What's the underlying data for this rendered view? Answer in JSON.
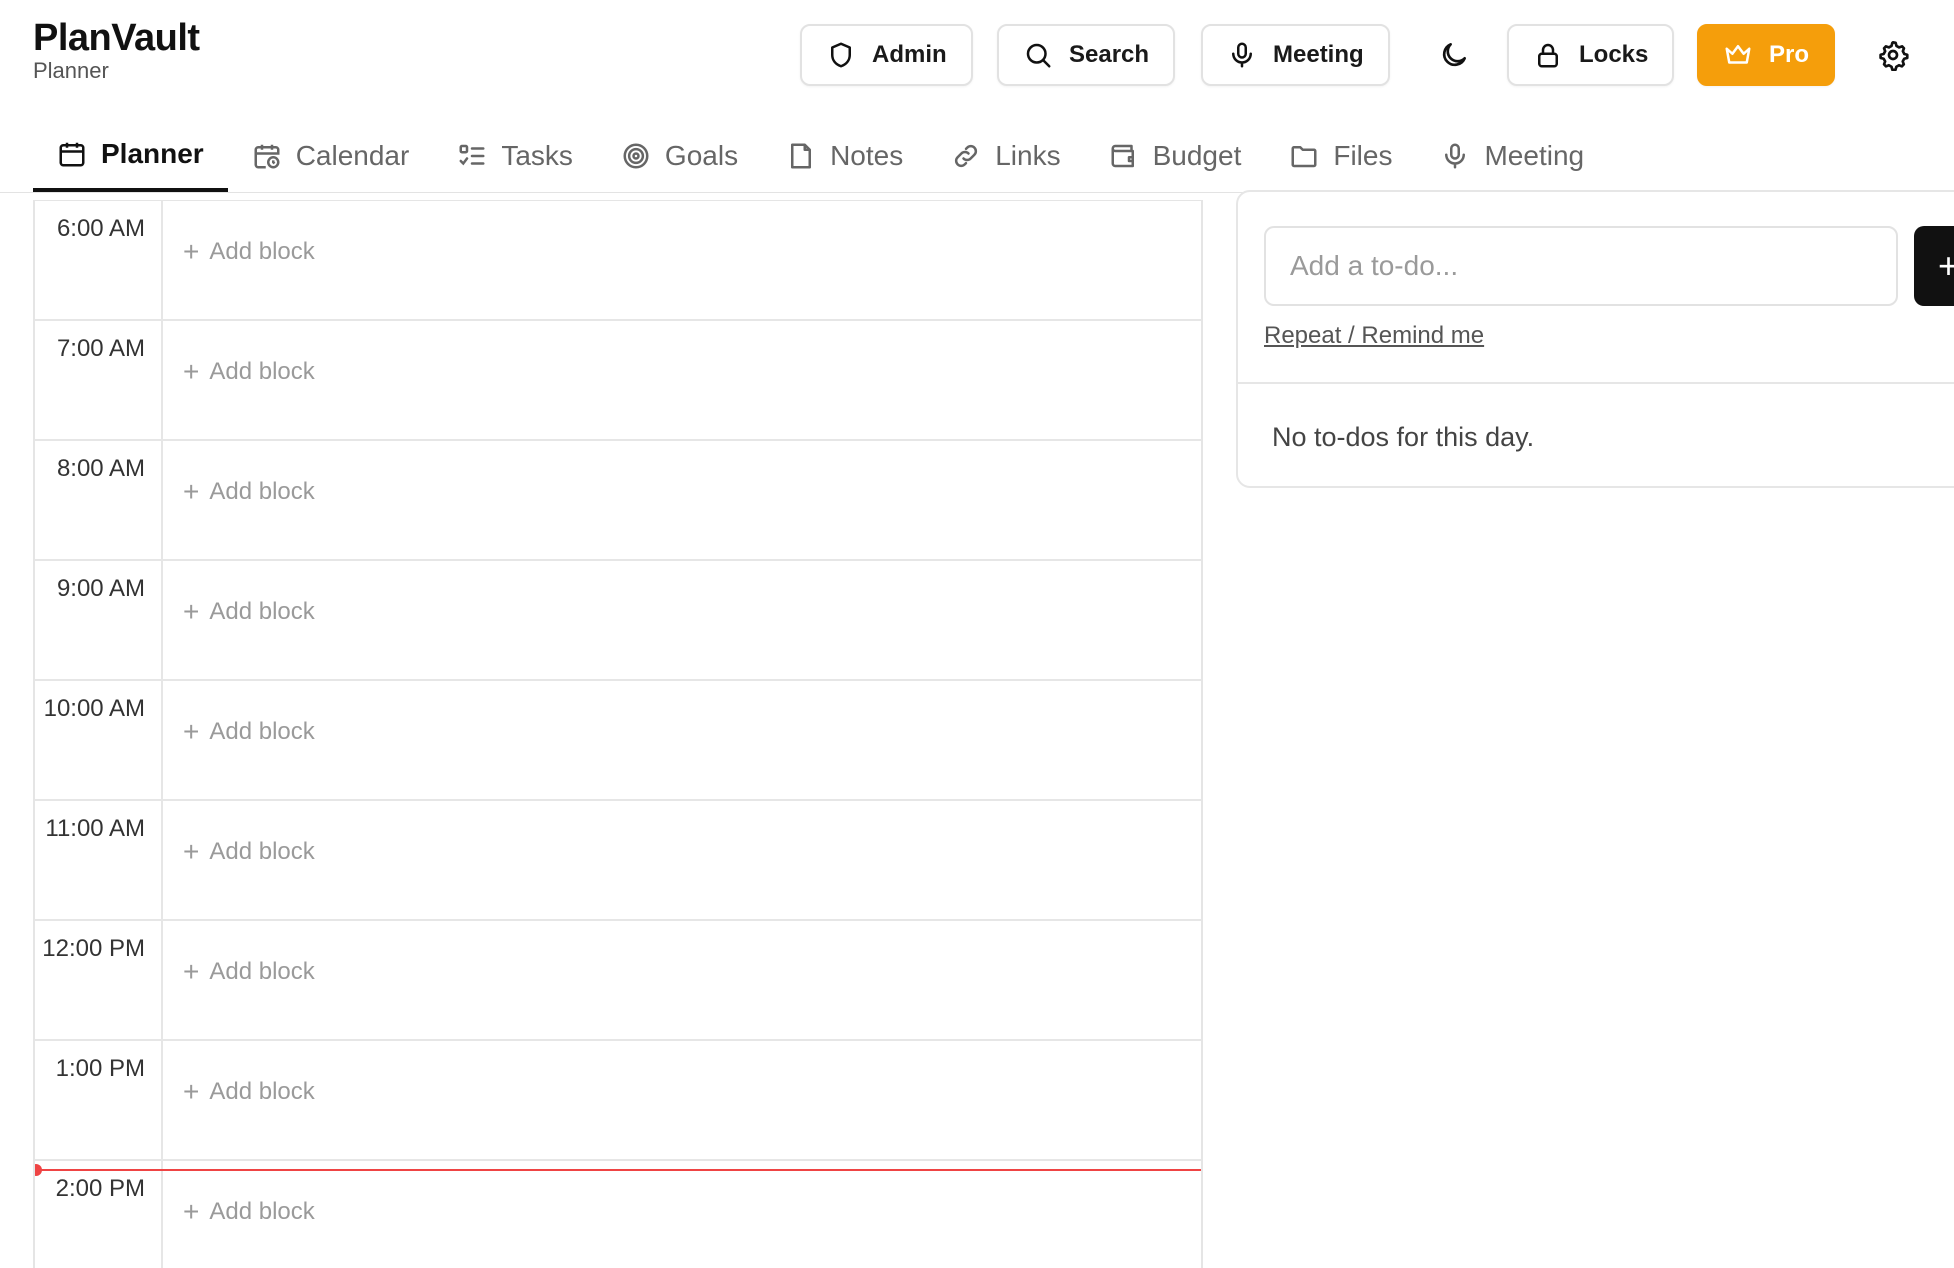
{
  "brand": {
    "title": "PlanVault",
    "subtitle": "Planner"
  },
  "header": {
    "admin_label": "Admin",
    "search_label": "Search",
    "meeting_label": "Meeting",
    "locks_label": "Locks",
    "pro_label": "Pro",
    "icons": [
      "shield-icon",
      "search-icon",
      "microphone-icon",
      "moon-icon",
      "lock-icon",
      "crown-icon",
      "gear-icon"
    ]
  },
  "tabs": [
    {
      "label": "Planner",
      "icon": "calendar-icon",
      "active": true
    },
    {
      "label": "Calendar",
      "icon": "calendar-clock-icon"
    },
    {
      "label": "Tasks",
      "icon": "checklist-icon"
    },
    {
      "label": "Goals",
      "icon": "target-icon"
    },
    {
      "label": "Notes",
      "icon": "note-icon"
    },
    {
      "label": "Links",
      "icon": "link-icon"
    },
    {
      "label": "Budget",
      "icon": "wallet-icon"
    },
    {
      "label": "Files",
      "icon": "folder-icon"
    },
    {
      "label": "Meeting",
      "icon": "microphone-icon"
    }
  ],
  "schedule": {
    "add_block_label": "Add block",
    "hours": [
      "6:00 AM",
      "7:00 AM",
      "8:00 AM",
      "9:00 AM",
      "10:00 AM",
      "11:00 AM",
      "12:00 PM",
      "1:00 PM",
      "2:00 PM"
    ]
  },
  "todo": {
    "placeholder": "Add a to-do...",
    "add_button": "+",
    "repeat_link": "Repeat / Remind me",
    "empty_message": "No to-dos for this day."
  },
  "colors": {
    "accent": "#f59e0b",
    "now_line": "#ef4444",
    "dark": "#111111"
  }
}
